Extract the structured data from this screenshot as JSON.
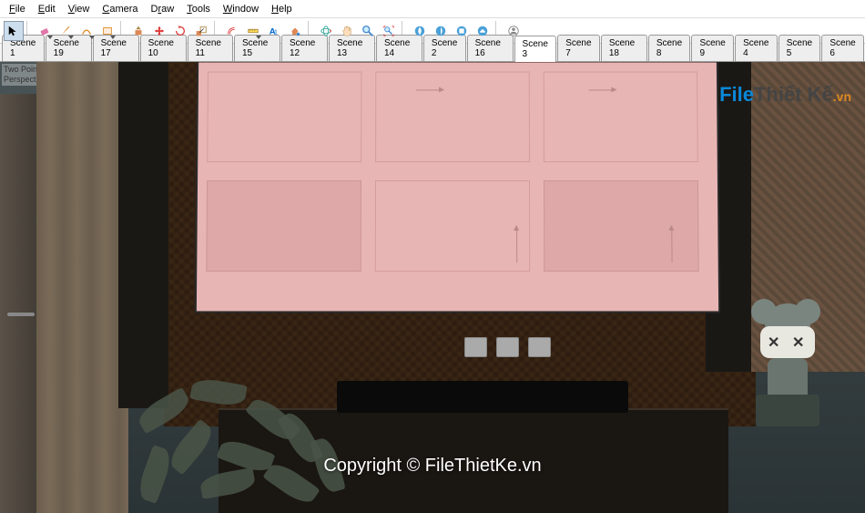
{
  "menu": {
    "file": "File",
    "edit": "Edit",
    "view": "View",
    "camera": "Camera",
    "draw": "Draw",
    "tools": "Tools",
    "window": "Window",
    "help": "Help"
  },
  "scenes": {
    "items": [
      {
        "label": "Scene 1",
        "active": false
      },
      {
        "label": "Scene 19",
        "active": false
      },
      {
        "label": "Scene 17",
        "active": false
      },
      {
        "label": "Scene 10",
        "active": false
      },
      {
        "label": "Scene 11",
        "active": false
      },
      {
        "label": "Scene 15",
        "active": false
      },
      {
        "label": "Scene 12",
        "active": false
      },
      {
        "label": "Scene 13",
        "active": false
      },
      {
        "label": "Scene 14",
        "active": false
      },
      {
        "label": "Scene 2",
        "active": false
      },
      {
        "label": "Scene 16",
        "active": false
      },
      {
        "label": "Scene 3",
        "active": true
      },
      {
        "label": "Scene 7",
        "active": false
      },
      {
        "label": "Scene 18",
        "active": false
      },
      {
        "label": "Scene 8",
        "active": false
      },
      {
        "label": "Scene 9",
        "active": false
      },
      {
        "label": "Scene 4",
        "active": false
      },
      {
        "label": "Scene 5",
        "active": false
      },
      {
        "label": "Scene 6",
        "active": false
      }
    ]
  },
  "viewport": {
    "projection_label": "Two Point\nPerspective"
  },
  "watermark": {
    "logo_file": "File",
    "logo_thietke": "Thiết Kế",
    "logo_vn": ".vn",
    "copyright": "Copyright © FileThietKe.vn"
  },
  "colors": {
    "accent": "#d82",
    "eraser": "#e078a8",
    "pencil": "#d82",
    "globe": "#3a9",
    "layers": "#4aa0d8"
  }
}
